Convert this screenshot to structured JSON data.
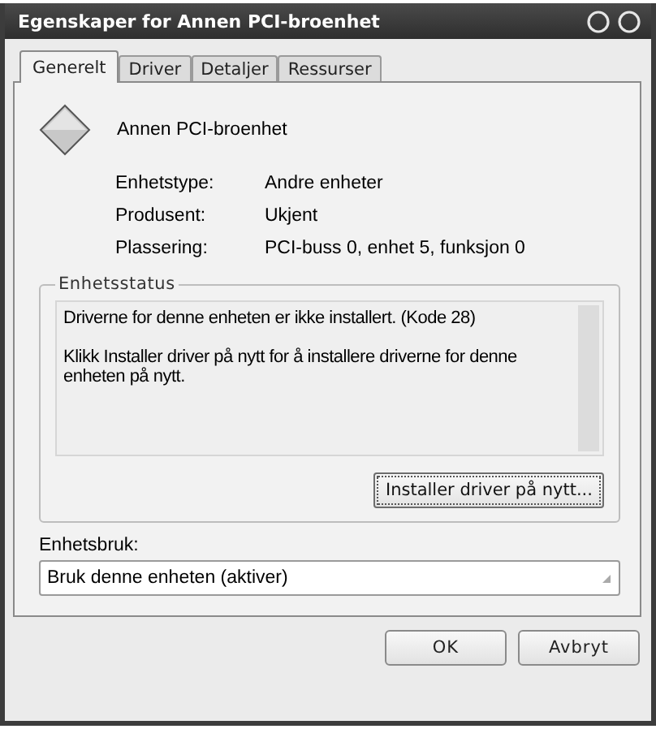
{
  "window": {
    "title": "Egenskaper for Annen PCI-broenhet"
  },
  "tabs": [
    {
      "label": "Generelt",
      "selected": true
    },
    {
      "label": "Driver",
      "selected": false
    },
    {
      "label": "Detaljer",
      "selected": false
    },
    {
      "label": "Ressurser",
      "selected": false
    }
  ],
  "device": {
    "name": "Annen PCI-broenhet"
  },
  "properties": [
    {
      "label": "Enhetstype:",
      "value": "Andre enheter"
    },
    {
      "label": "Produsent:",
      "value": "Ukjent"
    },
    {
      "label": "Plassering:",
      "value": "PCI-buss 0, enhet 5, funksjon 0"
    }
  ],
  "status_group": {
    "title": "Enhetsstatus",
    "paragraphs": [
      "Driverne for denne enheten er ikke installert. (Kode 28)",
      "Klikk Installer driver på nytt for å installere driverne for denne enheten på nytt."
    ],
    "button": "Installer driver på nytt..."
  },
  "usage": {
    "label": "Enhetsbruk:",
    "value": "Bruk denne enheten (aktiver)"
  },
  "buttons": [
    {
      "label": "OK"
    },
    {
      "label": "Avbryt"
    }
  ]
}
